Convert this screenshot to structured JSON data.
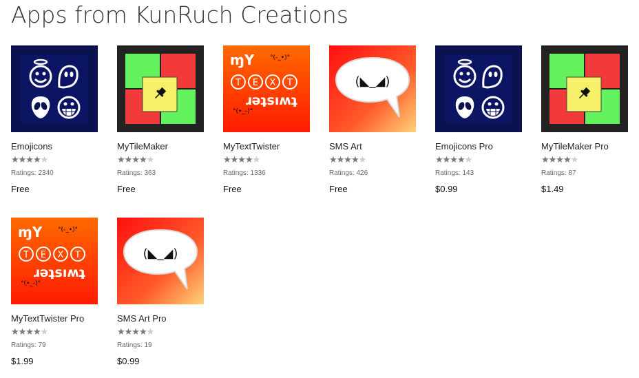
{
  "page": {
    "title": "Apps from KunRuch Creations"
  },
  "apps": [
    {
      "name": "Emojicons",
      "rating_stars": 4.0,
      "ratings_text": "Ratings: 2340",
      "price": "Free",
      "icon": "emojicons-tile",
      "stars_text": "★★★★",
      "stars_dim": "★"
    },
    {
      "name": "MyTileMaker",
      "rating_stars": 4.5,
      "ratings_text": "Ratings: 363",
      "price": "Free",
      "icon": "tilemaker-tile",
      "stars_text": "★★★★",
      "stars_dim": "★"
    },
    {
      "name": "MyTextTwister",
      "rating_stars": 4.5,
      "ratings_text": "Ratings: 1336",
      "price": "Free",
      "icon": "texttwister-tile",
      "stars_text": "★★★★",
      "stars_dim": "★"
    },
    {
      "name": "SMS Art",
      "rating_stars": 4.5,
      "ratings_text": "Ratings: 426",
      "price": "Free",
      "icon": "smsart-tile",
      "stars_text": "★★★★",
      "stars_dim": "★"
    },
    {
      "name": "Emojicons Pro",
      "rating_stars": 4.5,
      "ratings_text": "Ratings: 143",
      "price": "$0.99",
      "icon": "emojicons-tile",
      "stars_text": "★★★★",
      "stars_dim": "★"
    },
    {
      "name": "MyTileMaker Pro",
      "rating_stars": 4.5,
      "ratings_text": "Ratings: 87",
      "price": "$1.49",
      "icon": "tilemaker-tile",
      "stars_text": "★★★★",
      "stars_dim": "★"
    },
    {
      "name": "MyTextTwister Pro",
      "rating_stars": 4.5,
      "ratings_text": "Ratings: 79",
      "price": "$1.99",
      "icon": "texttwister-tile",
      "stars_text": "★★★★",
      "stars_dim": "★"
    },
    {
      "name": "SMS Art Pro",
      "rating_stars": 4.5,
      "ratings_text": "Ratings: 19",
      "price": "$0.99",
      "icon": "smsart-tile",
      "stars_text": "★★★★",
      "stars_dim": "★"
    }
  ],
  "tile_text": {
    "emoticon_face": "(◣_◢)",
    "twister_my": "ɱY",
    "twister_text": [
      "T",
      "E",
      "X",
      "T"
    ],
    "twister_flipped": "ɹǝʇsıʍʇ",
    "twister_small_top": "°(-_•)°",
    "twister_small_bottom": "°(•_-)°"
  },
  "colors": {
    "emoji_bg": "#0b1250",
    "tile_green": "#63f25e",
    "tile_red": "#f23a3a",
    "tile_yellow": "#f5ef6a",
    "tile_frame": "#222222",
    "twister_bg_top": "#ff6a00",
    "twister_bg_bottom": "#ff1b00",
    "sms_bg_from": "#ff0f0f",
    "sms_bg_to": "#ffd27a"
  }
}
